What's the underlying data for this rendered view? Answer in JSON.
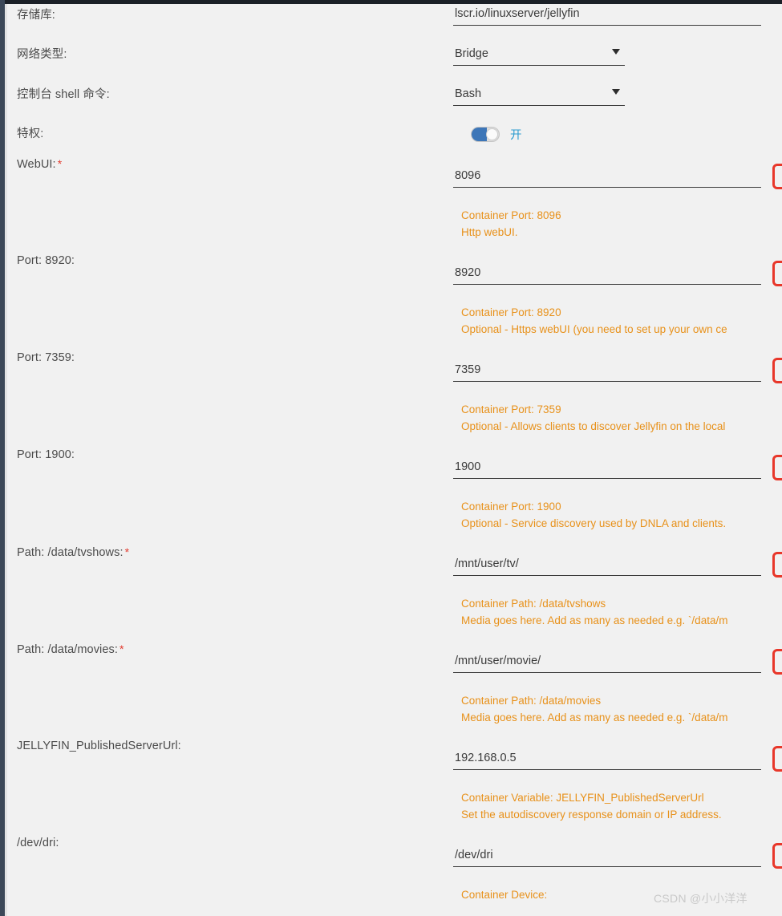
{
  "window": {
    "accent_red": "#e8372a",
    "accent_orange": "#e8911a",
    "accent_blue": "#3d76b8",
    "toggle_label_blue": "#2a9bd0",
    "surface": "#f1f1f1",
    "rail": "#3c4858"
  },
  "watermark": "CSDN @小小洋洋",
  "fields": [
    {
      "label": "存储库:",
      "required": false,
      "type": "text",
      "value": "lscr.io/linuxserver/jellyfin",
      "help": []
    },
    {
      "label": "网络类型:",
      "required": false,
      "type": "select",
      "value": "Bridge",
      "help": []
    },
    {
      "label": "控制台 shell 命令:",
      "required": false,
      "type": "select",
      "value": "Bash",
      "help": []
    },
    {
      "label": "特权:",
      "required": false,
      "type": "toggle",
      "value": "开",
      "state": "on",
      "help": []
    },
    {
      "label": "WebUI:",
      "required": true,
      "type": "text",
      "value": "8096",
      "help": [
        "Container Port: 8096",
        "Http webUI."
      ]
    },
    {
      "label": "Port: 8920:",
      "required": false,
      "type": "text",
      "value": "8920",
      "help": [
        "Container Port: 8920",
        "Optional - Https webUI (you need to set up your own ce"
      ]
    },
    {
      "label": "Port: 7359:",
      "required": false,
      "type": "text",
      "value": "7359",
      "help": [
        "Container Port: 7359",
        "Optional - Allows clients to discover Jellyfin on the local"
      ]
    },
    {
      "label": "Port: 1900:",
      "required": false,
      "type": "text",
      "value": "1900",
      "help": [
        "Container Port: 1900",
        "Optional - Service discovery used by DNLA and clients."
      ]
    },
    {
      "label": "Path: /data/tvshows:",
      "required": true,
      "type": "text",
      "value": "/mnt/user/tv/",
      "help": [
        "Container Path: /data/tvshows",
        "Media goes here. Add as many as needed e.g. `/data/m"
      ]
    },
    {
      "label": "Path: /data/movies:",
      "required": true,
      "type": "text",
      "value": "/mnt/user/movie/",
      "help": [
        "Container Path: /data/movies",
        "Media goes here. Add as many as needed e.g. `/data/m"
      ]
    },
    {
      "label": "JELLYFIN_PublishedServerUrl:",
      "required": false,
      "type": "text",
      "value": "192.168.0.5",
      "help": [
        "Container Variable: JELLYFIN_PublishedServerUrl",
        "Set the autodiscovery response domain or IP address."
      ]
    },
    {
      "label": "/dev/dri:",
      "required": false,
      "type": "text",
      "value": "/dev/dri",
      "help": [
        "Container Device:"
      ]
    }
  ],
  "layout": {
    "label_tops": [
      10,
      59,
      109,
      158,
      195,
      316,
      437,
      558,
      679,
      800,
      921,
      1042
    ],
    "field_tops": [
      8,
      58,
      108,
      155,
      210,
      331,
      452,
      573,
      694,
      815,
      936,
      1057
    ],
    "help_tops": [
      null,
      null,
      null,
      null,
      258,
      379,
      500,
      621,
      742,
      863,
      984,
      1105
    ],
    "button_tops": [
      null,
      null,
      null,
      null,
      204,
      325,
      446,
      567,
      688,
      809,
      930,
      1051
    ]
  }
}
